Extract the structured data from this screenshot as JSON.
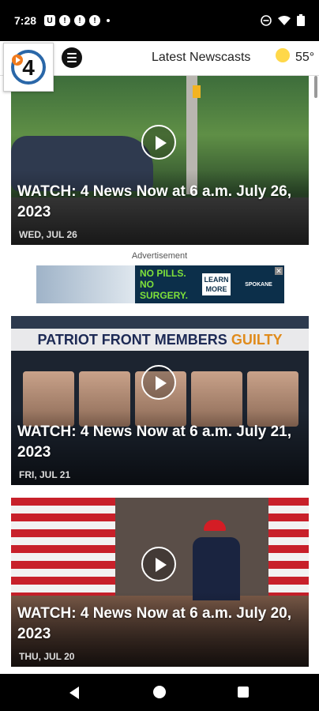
{
  "status_bar": {
    "time": "7:28",
    "icons": [
      "u-icon",
      "alert-icon",
      "alert-icon",
      "alert-icon",
      "dot"
    ],
    "right_icons": [
      "dnd-icon",
      "wifi-icon",
      "battery-icon"
    ]
  },
  "header": {
    "logo_name": "4-news-logo",
    "title": "Latest Newscasts",
    "temperature": "55°"
  },
  "cards": [
    {
      "title": "WATCH: 4 News Now at 6 a.m. July 26, 2023",
      "date": "WED, JUL 26"
    },
    {
      "title": "WATCH: 4 News Now at 6 a.m. July 21, 2023",
      "date": "FRI, JUL 21",
      "headline": "PATRIOT FRONT MEMBERS",
      "headline_accent": "GUILTY"
    },
    {
      "title": "WATCH: 4 News Now at 6 a.m. July 20, 2023",
      "date": "THU, JUL 20"
    }
  ],
  "ad": {
    "label": "Advertisement",
    "text": "NO PILLS. NO SURGERY.",
    "button": "LEARN MORE",
    "brand": "SPOKANE",
    "close": "✕"
  },
  "colors": {
    "header_bg": "#ffffff",
    "accent_orange": "#e08b1c",
    "ad_green": "#7ee03a"
  }
}
